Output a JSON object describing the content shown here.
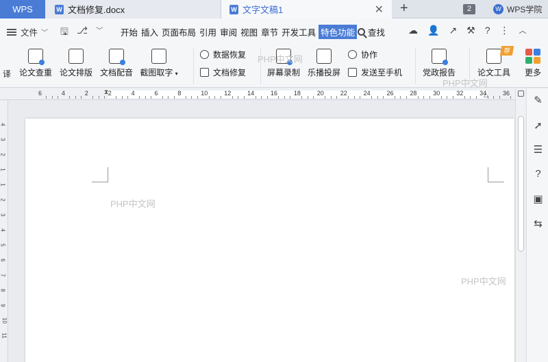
{
  "tabs": {
    "wps_label": "WPS",
    "doc1_label": "文档修复.docx",
    "doc2_label": "文字文稿1",
    "close_glyph": "✕",
    "add_glyph": "+",
    "window_count": "2",
    "academy_label": "WPS学院"
  },
  "menu": {
    "file_label": "文件",
    "items": [
      "开始",
      "插入",
      "页面布局",
      "引用",
      "审阅",
      "视图",
      "章节",
      "开发工具",
      "特色功能"
    ],
    "active_item": "特色功能",
    "search_label": "查找"
  },
  "ribbon": {
    "cut_off_label": "译",
    "thesis_check": "论文查重",
    "thesis_layout": "论文排版",
    "doc_dubbing": "文档配音",
    "screenshot_ocr": "截图取字",
    "data_recovery": "数据恢复",
    "doc_repair": "文档修复",
    "screen_record": "屏幕录制",
    "cast_screen": "乐播投屏",
    "collaborate": "协作",
    "send_to_phone": "发送至手机",
    "party_report": "党政报告",
    "thesis_tool": "论文工具",
    "thesis_badge": "荐",
    "more": "更多"
  },
  "ruler": {
    "labels": [
      "6",
      "4",
      "2",
      "2",
      "4",
      "6",
      "8",
      "10",
      "12",
      "14",
      "16",
      "18",
      "20",
      "22",
      "24",
      "26",
      "28",
      "30",
      "32",
      "34",
      "36"
    ]
  },
  "vruler": {
    "labels": [
      "4",
      "3",
      "2",
      "1",
      "1",
      "2",
      "3",
      "4",
      "5",
      "6",
      "7",
      "8",
      "9",
      "10",
      "11"
    ]
  },
  "watermarks": {
    "text": "PHP中文网"
  },
  "colors": {
    "accent": "#4a7cd6",
    "page": "#ffffff",
    "canvas": "#e9ebee"
  }
}
